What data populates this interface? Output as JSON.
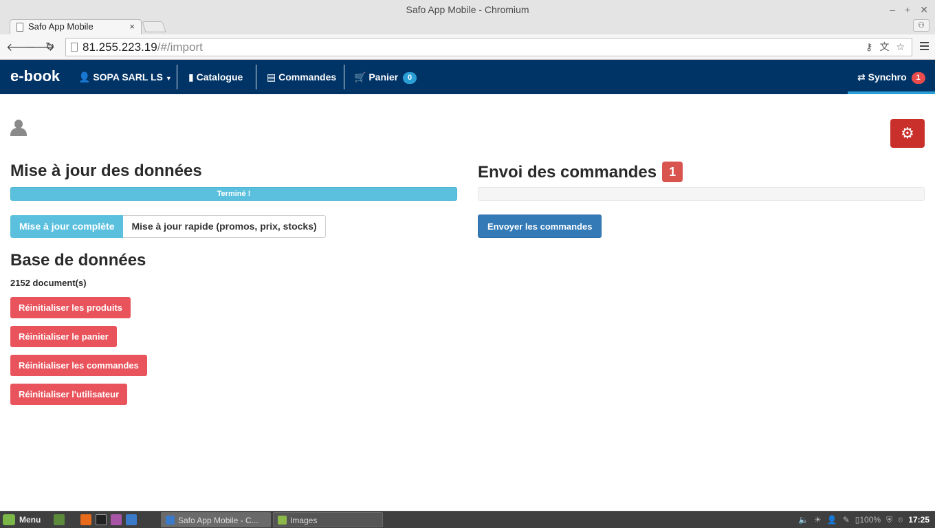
{
  "window": {
    "title": "Safo App Mobile - Chromium"
  },
  "browser": {
    "tab_title": "Safo App Mobile",
    "url_host": "81.255.223.19",
    "url_path": "/#/import"
  },
  "navbar": {
    "brand": "e-book",
    "user_label": "SOPA SARL LS",
    "catalogue_label": "Catalogue",
    "commandes_label": "Commandes",
    "panier_label": "Panier",
    "panier_count": "0",
    "synchro_label": "Synchro",
    "synchro_count": "1",
    "bg_color": "#003366"
  },
  "update_section": {
    "title": "Mise à jour des données",
    "progress_text": "Terminé !",
    "progress_fraction": 1.0,
    "full_update_label": "Mise à jour complète",
    "quick_update_label": "Mise à jour rapide (promos, prix, stocks)"
  },
  "database_section": {
    "title": "Base de données",
    "doc_count": "2152 document(s)",
    "reset_products_label": "Réinitialiser les produits",
    "reset_cart_label": "Réinitialiser le panier",
    "reset_orders_label": "Réinitialiser les commandes",
    "reset_user_label": "Réinitialiser l'utilisateur"
  },
  "orders_section": {
    "title": "Envoi des commandes",
    "pending_count": "1",
    "progress_fraction": 0,
    "send_label": "Envoyer les commandes"
  },
  "taskbar": {
    "menu_label": "Menu",
    "window_1": "Safo App Mobile - C...",
    "window_2": "Images",
    "battery": "100%",
    "clock": "17:25"
  }
}
